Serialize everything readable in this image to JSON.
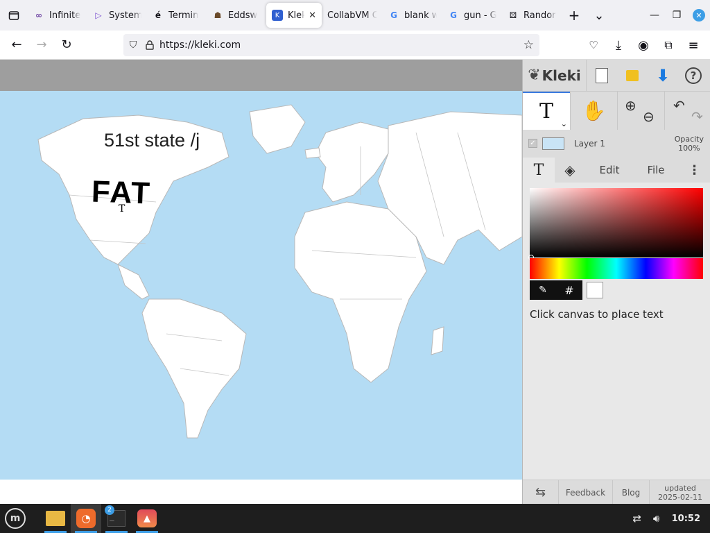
{
  "browser": {
    "tabs": [
      {
        "label": "Infinite",
        "icon": "infinity-icon"
      },
      {
        "label": "System",
        "icon": "play-icon"
      },
      {
        "label": "Termin",
        "icon": "terminal-e-icon"
      },
      {
        "label": "Eddsw",
        "icon": "group-icon"
      },
      {
        "label": "Kleki",
        "icon": "kleki-icon",
        "active": true
      },
      {
        "label": "CollabVM C",
        "icon": ""
      },
      {
        "label": "blank w",
        "icon": "google-icon"
      },
      {
        "label": "gun - G",
        "icon": "google-icon"
      },
      {
        "label": "Randor",
        "icon": "dice-icon"
      }
    ],
    "new_tab": "+",
    "tab_list": "⌄",
    "url": "https://kleki.com"
  },
  "canvas": {
    "text_1": "51st state /j",
    "text_2": "FAT",
    "cursor_glyph": "T"
  },
  "kleki": {
    "logo": "Kleki",
    "active_tool_glyph": "T",
    "layer_name": "Layer 1",
    "opacity_label": "Opacity",
    "opacity_value": "100%",
    "tabs": {
      "tool": "T",
      "edit": "Edit",
      "file": "File"
    },
    "hex_label": "#",
    "hint": "Click canvas to place text",
    "bottom": {
      "feedback": "Feedback",
      "blog": "Blog",
      "updated_label": "updated",
      "updated_date": "2025-02-11"
    },
    "accent_color": "#3a7ae0"
  },
  "taskbar": {
    "terminal_badge": "2",
    "clock": "10:52"
  }
}
